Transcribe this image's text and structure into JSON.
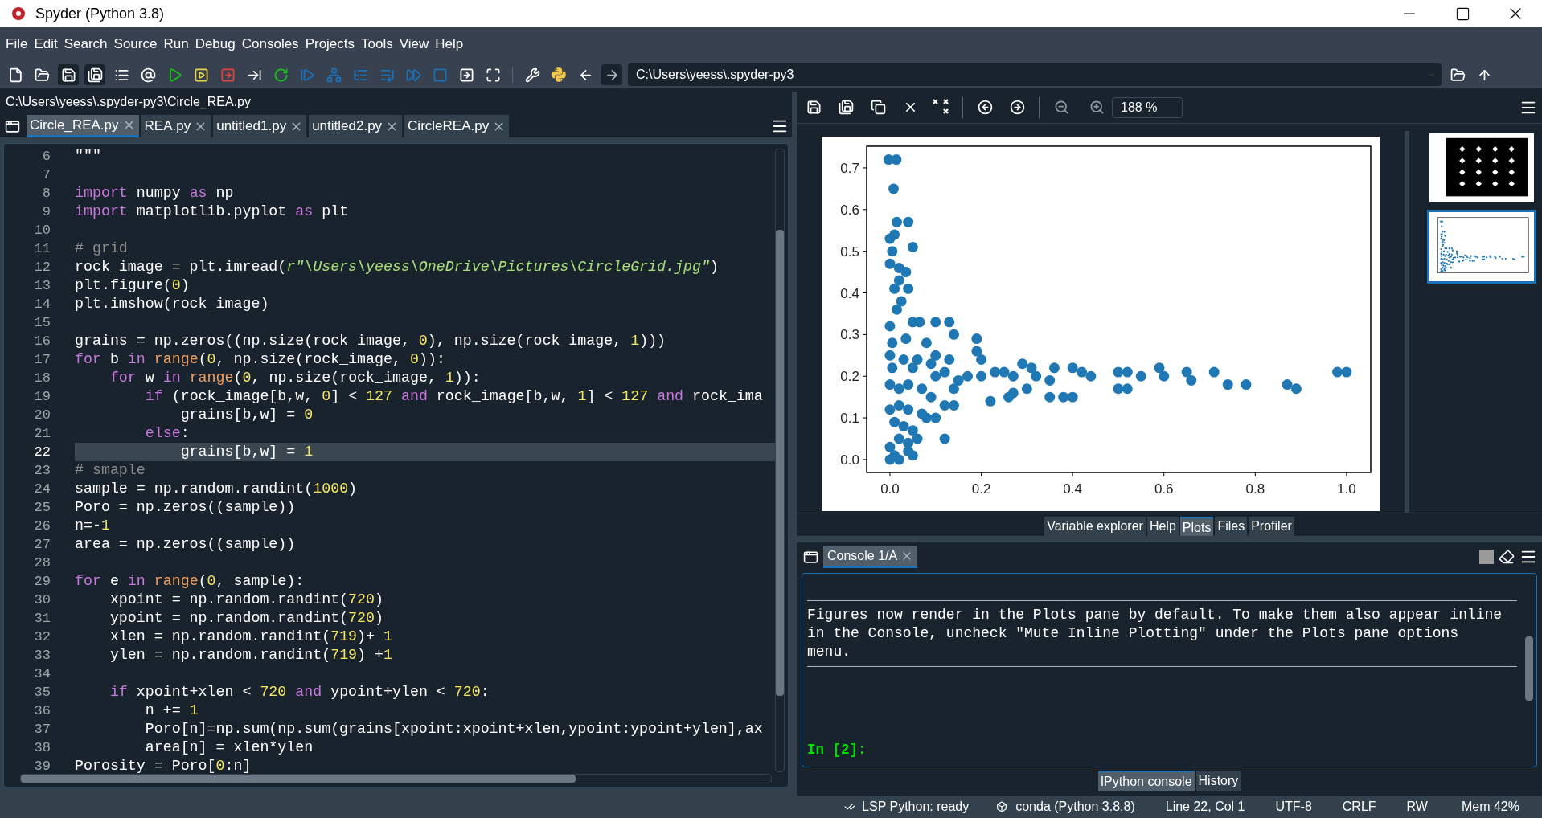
{
  "window": {
    "title": "Spyder (Python 3.8)"
  },
  "menu": [
    "File",
    "Edit",
    "Search",
    "Source",
    "Run",
    "Debug",
    "Consoles",
    "Projects",
    "Tools",
    "View",
    "Help"
  ],
  "toolbar": {
    "path": "C:\\Users\\yeess\\.spyder-py3"
  },
  "editor": {
    "file_path": "C:\\Users\\yeess\\.spyder-py3\\Circle_REA.py",
    "tabs": [
      {
        "label": "Circle_REA.py",
        "selected": true
      },
      {
        "label": "REA.py",
        "selected": false
      },
      {
        "label": "untitled1.py",
        "selected": false
      },
      {
        "label": "untitled2.py",
        "selected": false
      },
      {
        "label": "CircleREA.py",
        "selected": false
      }
    ],
    "lines": [
      {
        "no": "6",
        "current": false,
        "seg": [
          {
            "kind": "plain",
            "text": "\"\"\""
          }
        ]
      },
      {
        "no": "7",
        "current": false
      },
      {
        "no": "8",
        "current": false,
        "seg": [
          {
            "kind": "keyword",
            "text": "import"
          },
          {
            "kind": "plain",
            "text": " numpy "
          },
          {
            "kind": "keyword",
            "text": "as"
          },
          {
            "kind": "plain",
            "text": " np"
          }
        ]
      },
      {
        "no": "9",
        "current": false,
        "seg": [
          {
            "kind": "keyword",
            "text": "import"
          },
          {
            "kind": "plain",
            "text": " matplotlib.pyplot "
          },
          {
            "kind": "keyword",
            "text": "as"
          },
          {
            "kind": "plain",
            "text": " plt"
          }
        ]
      },
      {
        "no": "10",
        "current": false
      },
      {
        "no": "11",
        "current": false,
        "seg": [
          {
            "kind": "comment",
            "text": "# grid"
          }
        ]
      },
      {
        "no": "12",
        "current": false,
        "seg": [
          {
            "kind": "plain",
            "text": "rock_image = plt.imread("
          },
          {
            "kind": "string",
            "text": "r\"\\Users\\yeess\\OneDrive\\Pictures\\CircleGrid.jpg\""
          },
          {
            "kind": "plain",
            "text": ")"
          }
        ]
      },
      {
        "no": "13",
        "current": false,
        "seg": [
          {
            "kind": "plain",
            "text": "plt.figure("
          },
          {
            "kind": "number",
            "text": "0"
          },
          {
            "kind": "plain",
            "text": ")"
          }
        ]
      },
      {
        "no": "14",
        "current": false,
        "seg": [
          {
            "kind": "plain",
            "text": "plt.imshow(rock_image)"
          }
        ]
      },
      {
        "no": "15",
        "current": false
      },
      {
        "no": "16",
        "current": false,
        "seg": [
          {
            "kind": "plain",
            "text": "grains = np.zeros((np.size(rock_image, "
          },
          {
            "kind": "number",
            "text": "0"
          },
          {
            "kind": "plain",
            "text": "), np.size(rock_image, "
          },
          {
            "kind": "number",
            "text": "1"
          },
          {
            "kind": "plain",
            "text": ")))"
          }
        ]
      },
      {
        "no": "17",
        "current": false,
        "seg": [
          {
            "kind": "keyword",
            "text": "for"
          },
          {
            "kind": "plain",
            "text": " b "
          },
          {
            "kind": "keyword",
            "text": "in "
          },
          {
            "kind": "builtin",
            "text": "range"
          },
          {
            "kind": "plain",
            "text": "("
          },
          {
            "kind": "number",
            "text": "0"
          },
          {
            "kind": "plain",
            "text": ", np.size(rock_image, "
          },
          {
            "kind": "number",
            "text": "0"
          },
          {
            "kind": "plain",
            "text": ")):"
          }
        ]
      },
      {
        "no": "18",
        "current": false,
        "seg": [
          {
            "kind": "keyword",
            "text": "    for"
          },
          {
            "kind": "plain",
            "text": " w "
          },
          {
            "kind": "keyword",
            "text": "in "
          },
          {
            "kind": "builtin",
            "text": "range"
          },
          {
            "kind": "plain",
            "text": "("
          },
          {
            "kind": "number",
            "text": "0"
          },
          {
            "kind": "plain",
            "text": ", np.size(rock_image, "
          },
          {
            "kind": "number",
            "text": "1"
          },
          {
            "kind": "plain",
            "text": ")):"
          }
        ]
      },
      {
        "no": "19",
        "current": false,
        "seg": [
          {
            "kind": "keyword",
            "text": "        if"
          },
          {
            "kind": "plain",
            "text": " (rock_image[b,w, "
          },
          {
            "kind": "number",
            "text": "0"
          },
          {
            "kind": "plain",
            "text": "] < "
          },
          {
            "kind": "number",
            "text": "127 "
          },
          {
            "kind": "keyword",
            "text": "and"
          },
          {
            "kind": "plain",
            "text": " rock_image[b,w, "
          },
          {
            "kind": "number",
            "text": "1"
          },
          {
            "kind": "plain",
            "text": "] < "
          },
          {
            "kind": "number",
            "text": "127 "
          },
          {
            "kind": "keyword",
            "text": "and"
          },
          {
            "kind": "plain",
            "text": " rock_ima"
          }
        ]
      },
      {
        "no": "20",
        "current": false,
        "seg": [
          {
            "kind": "plain",
            "text": "            grains[b,w] = "
          },
          {
            "kind": "number",
            "text": "0"
          }
        ]
      },
      {
        "no": "21",
        "current": false,
        "seg": [
          {
            "kind": "keyword",
            "text": "        else"
          },
          {
            "kind": "plain",
            "text": ":"
          }
        ]
      },
      {
        "no": "22",
        "current": true,
        "seg": [
          {
            "kind": "plain",
            "text": "            grains[b,w] = "
          },
          {
            "kind": "number",
            "text": "1"
          }
        ]
      },
      {
        "no": "23",
        "current": false,
        "seg": [
          {
            "kind": "comment",
            "text": "# smaple"
          }
        ]
      },
      {
        "no": "24",
        "current": false,
        "seg": [
          {
            "kind": "plain",
            "text": "sample = np.random.randint("
          },
          {
            "kind": "number",
            "text": "1000"
          },
          {
            "kind": "plain",
            "text": ")"
          }
        ]
      },
      {
        "no": "25",
        "current": false,
        "seg": [
          {
            "kind": "plain",
            "text": "Poro = np.zeros((sample))"
          }
        ]
      },
      {
        "no": "26",
        "current": false,
        "seg": [
          {
            "kind": "plain",
            "text": "n=-"
          },
          {
            "kind": "number",
            "text": "1"
          }
        ]
      },
      {
        "no": "27",
        "current": false,
        "seg": [
          {
            "kind": "plain",
            "text": "area = np.zeros((sample))"
          }
        ]
      },
      {
        "no": "28",
        "current": false
      },
      {
        "no": "29",
        "current": false,
        "seg": [
          {
            "kind": "keyword",
            "text": "for"
          },
          {
            "kind": "plain",
            "text": " e "
          },
          {
            "kind": "keyword",
            "text": "in "
          },
          {
            "kind": "builtin",
            "text": "range"
          },
          {
            "kind": "plain",
            "text": "("
          },
          {
            "kind": "number",
            "text": "0"
          },
          {
            "kind": "plain",
            "text": ", sample):"
          }
        ]
      },
      {
        "no": "30",
        "current": false,
        "seg": [
          {
            "kind": "plain",
            "text": "    xpoint = np.random.randint("
          },
          {
            "kind": "number",
            "text": "720"
          },
          {
            "kind": "plain",
            "text": ")"
          }
        ]
      },
      {
        "no": "31",
        "current": false,
        "seg": [
          {
            "kind": "plain",
            "text": "    ypoint = np.random.randint("
          },
          {
            "kind": "number",
            "text": "720"
          },
          {
            "kind": "plain",
            "text": ")"
          }
        ]
      },
      {
        "no": "32",
        "current": false,
        "seg": [
          {
            "kind": "plain",
            "text": "    xlen = np.random.randint("
          },
          {
            "kind": "number",
            "text": "719"
          },
          {
            "kind": "plain",
            "text": ")+ "
          },
          {
            "kind": "number",
            "text": "1"
          }
        ]
      },
      {
        "no": "33",
        "current": false,
        "seg": [
          {
            "kind": "plain",
            "text": "    ylen = np.random.randint("
          },
          {
            "kind": "number",
            "text": "719"
          },
          {
            "kind": "plain",
            "text": ") +"
          },
          {
            "kind": "number",
            "text": "1"
          }
        ]
      },
      {
        "no": "34",
        "current": false
      },
      {
        "no": "35",
        "current": false,
        "seg": [
          {
            "kind": "keyword",
            "text": "    if"
          },
          {
            "kind": "plain",
            "text": " xpoint+xlen < "
          },
          {
            "kind": "number",
            "text": "720 "
          },
          {
            "kind": "keyword",
            "text": "and"
          },
          {
            "kind": "plain",
            "text": " ypoint+ylen < "
          },
          {
            "kind": "number",
            "text": "720"
          },
          {
            "kind": "plain",
            "text": ":"
          }
        ]
      },
      {
        "no": "36",
        "current": false,
        "seg": [
          {
            "kind": "plain",
            "text": "        n += "
          },
          {
            "kind": "number",
            "text": "1"
          }
        ]
      },
      {
        "no": "37",
        "current": false,
        "seg": [
          {
            "kind": "plain",
            "text": "        Poro[n]=np.sum(np.sum(grains[xpoint:xpoint+xlen,ypoint:ypoint+ylen],ax"
          }
        ]
      },
      {
        "no": "38",
        "current": false,
        "seg": [
          {
            "kind": "plain",
            "text": "        area[n] = xlen*ylen"
          }
        ]
      },
      {
        "no": "39",
        "current": false,
        "seg": [
          {
            "kind": "plain",
            "text": "Porosity = Poro["
          },
          {
            "kind": "number",
            "text": "0"
          },
          {
            "kind": "plain",
            "text": ":n]"
          }
        ]
      }
    ]
  },
  "plots": {
    "zoom": "188 %",
    "chart_data": {
      "type": "scatter",
      "x": [
        -0.003,
        0.014,
        0.008,
        0.015,
        0.04,
        0.0,
        0.01,
        0.005,
        0.05,
        0.0,
        0.02,
        0.035,
        0.02,
        0.01,
        0.04,
        0.025,
        0.015,
        0.05,
        0.065,
        0.1,
        0.13,
        0.14,
        0.19,
        0.19,
        0.0,
        0.005,
        0.035,
        0.08,
        0.0,
        0.03,
        0.06,
        0.1,
        0.13,
        0.2,
        0.005,
        0.05,
        0.09,
        0.12,
        0.15,
        0.0,
        0.02,
        0.04,
        0.07,
        0.1,
        0.14,
        0.17,
        0.2,
        0.23,
        0.25,
        0.27,
        0.29,
        0.31,
        0.32,
        0.35,
        0.36,
        0.4,
        0.42,
        0.44,
        0.5,
        0.52,
        0.55,
        0.59,
        0.6,
        0.65,
        0.66,
        0.71,
        0.74,
        0.78,
        0.87,
        0.89,
        0.98,
        1.0,
        0.5,
        0.52,
        0.3,
        0.27,
        0.22,
        0.26,
        0.35,
        0.38,
        0.4,
        0.09,
        0.12,
        0.14,
        0.0,
        0.02,
        0.04,
        0.07,
        0.08,
        0.1,
        0.12,
        0.01,
        0.03,
        0.05,
        0.02,
        0.04,
        0.06,
        0.0,
        0.01,
        0.0,
        0.02,
        0.04,
        0.05
      ],
      "series": [
        {
          "color": "#1f77b4",
          "values": [
            0.72,
            0.72,
            0.65,
            0.57,
            0.57,
            0.53,
            0.54,
            0.5,
            0.51,
            0.47,
            0.46,
            0.45,
            0.43,
            0.41,
            0.41,
            0.38,
            0.36,
            0.33,
            0.33,
            0.33,
            0.33,
            0.3,
            0.29,
            0.26,
            0.32,
            0.28,
            0.29,
            0.28,
            0.25,
            0.24,
            0.24,
            0.25,
            0.24,
            0.24,
            0.22,
            0.22,
            0.23,
            0.21,
            0.19,
            0.18,
            0.17,
            0.18,
            0.17,
            0.2,
            0.17,
            0.2,
            0.2,
            0.21,
            0.21,
            0.2,
            0.23,
            0.22,
            0.2,
            0.19,
            0.22,
            0.22,
            0.21,
            0.2,
            0.21,
            0.21,
            0.2,
            0.22,
            0.2,
            0.21,
            0.19,
            0.21,
            0.18,
            0.18,
            0.18,
            0.17,
            0.21,
            0.21,
            0.17,
            0.17,
            0.17,
            0.16,
            0.14,
            0.15,
            0.15,
            0.15,
            0.15,
            0.15,
            0.13,
            0.13,
            0.12,
            0.13,
            0.12,
            0.11,
            0.1,
            0.1,
            0.05,
            0.09,
            0.08,
            0.07,
            0.05,
            0.04,
            0.05,
            0.03,
            0.01,
            0.0,
            0.0,
            0.02,
            0.01
          ]
        }
      ],
      "xlim": [
        -0.051,
        1.053
      ],
      "ylim": [
        -0.031,
        0.752
      ],
      "xticks": [
        {
          "value": 0,
          "label": "0.0"
        },
        {
          "value": 0.2,
          "label": "0.2"
        },
        {
          "value": 0.4,
          "label": "0.4"
        },
        {
          "value": 0.6,
          "label": "0.6"
        },
        {
          "value": 0.8,
          "label": "0.8"
        },
        {
          "value": 1.0,
          "label": "1.0"
        }
      ],
      "yticks": [
        {
          "value": 0,
          "label": "0.0"
        },
        {
          "value": 0.1,
          "label": "0.1"
        },
        {
          "value": 0.2,
          "label": "0.2"
        },
        {
          "value": 0.3,
          "label": "0.3"
        },
        {
          "value": 0.4,
          "label": "0.4"
        },
        {
          "value": 0.5,
          "label": "0.5"
        },
        {
          "value": 0.6,
          "label": "0.6"
        },
        {
          "value": 0.7,
          "label": "0.7"
        }
      ]
    },
    "thumbnails": [
      {
        "kind": "image",
        "selected": false
      },
      {
        "kind": "scatter",
        "selected": true
      }
    ]
  },
  "pane_tabs": [
    {
      "label": "Variable explorer",
      "selected": false
    },
    {
      "label": "Help",
      "selected": false
    },
    {
      "label": "Plots",
      "selected": true
    },
    {
      "label": "Files",
      "selected": false
    },
    {
      "label": "Profiler",
      "selected": false
    }
  ],
  "console": {
    "tab": "Console 1/A",
    "message": "Figures now render in the Plots pane by default. To make them also appear inline in the Console, uncheck \"Mute Inline Plotting\" under the Plots pane options menu.",
    "prompt": "In [2]:"
  },
  "console_tabs": [
    {
      "label": "IPython console",
      "selected": true
    },
    {
      "label": "History",
      "selected": false
    }
  ],
  "status_bar": {
    "lsp": "LSP Python: ready",
    "env": "conda (Python 3.8.8)",
    "position": "Line 22, Col 1",
    "encoding": "UTF-8",
    "eol": "CRLF",
    "mode": "RW",
    "memory": "Mem 42%"
  }
}
